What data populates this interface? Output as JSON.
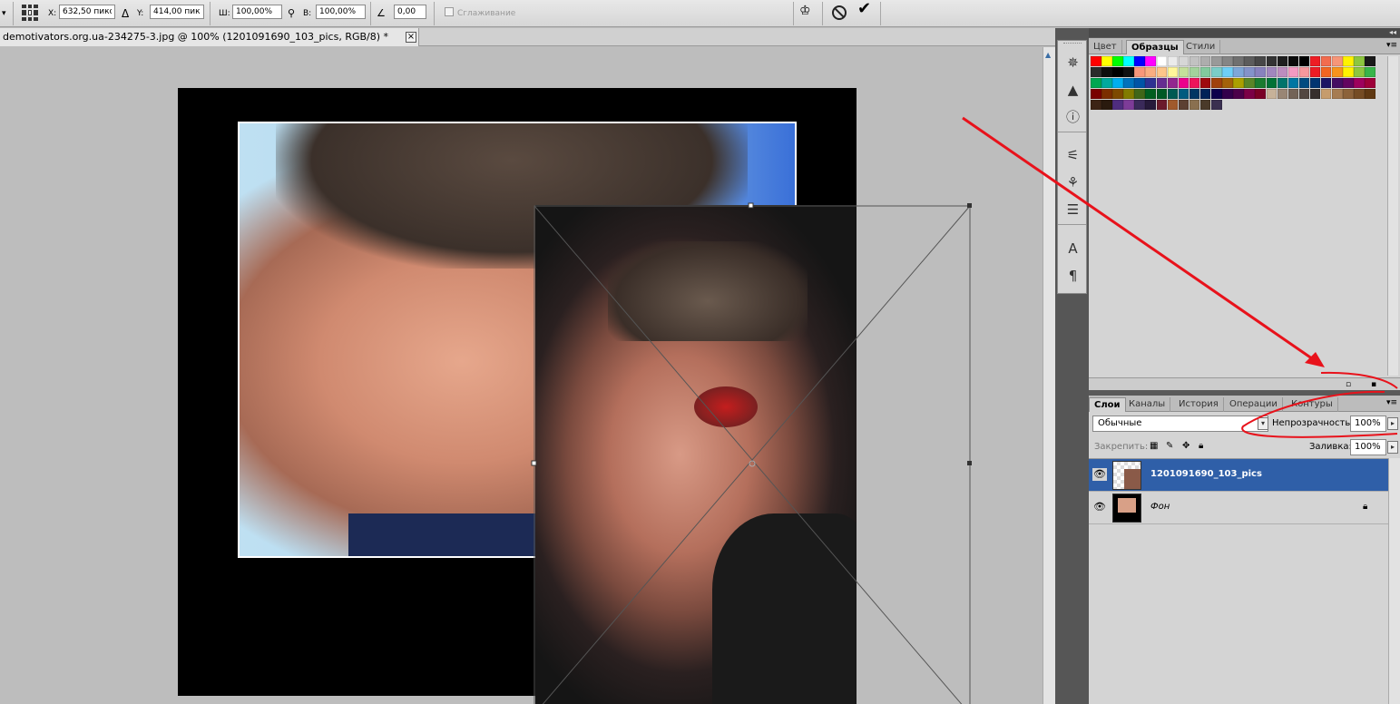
{
  "options_bar": {
    "x_label": "X:",
    "x_value": "632,50 пикс",
    "delta_icon": "Δ",
    "y_label": "Y:",
    "y_value": "414,00 пикс",
    "w_label": "Ш:",
    "w_value": "100,00%",
    "h_label": "В:",
    "h_value": "100,00%",
    "angle_value": "0,00",
    "antialias_label": "Сглаживание",
    "icons": [
      "reference-point-icon",
      "link-icon",
      "angle-icon",
      "warp-icon",
      "cancel-icon",
      "commit-icon"
    ]
  },
  "document": {
    "tab_title": "demotivators.org.ua-234275-3.jpg @ 100% (1201091690_103_pics, RGB/8) *",
    "close_label": "×"
  },
  "swatch_panel": {
    "collapse_label": "◂◂",
    "tabs": [
      "Цвет",
      "Образцы",
      "Стили"
    ],
    "active_tab": "Образцы",
    "swatches": [
      "#ff0000",
      "#ffff00",
      "#00ff00",
      "#00ffff",
      "#0000ff",
      "#ff00ff",
      "#ffffff",
      "#ebebeb",
      "#d6d6d6",
      "#c2c2c2",
      "#adadad",
      "#999999",
      "#858585",
      "#707070",
      "#5c5c5c",
      "#474747",
      "#333333",
      "#1f1f1f",
      "#0a0a0a",
      "#000000",
      "#ee1d24",
      "#f26c4f",
      "#f69679",
      "#fff200",
      "#8dc63f",
      "#1a1a1a",
      "#2b2b2b",
      "#0d0d0d",
      "#000000",
      "#101010",
      "#f7977a",
      "#f9ad81",
      "#fdc68a",
      "#fff79a",
      "#c4df9b",
      "#a3d39c",
      "#82ca9d",
      "#7bcdc8",
      "#6ecff6",
      "#7ea7d8",
      "#8493ca",
      "#8882be",
      "#a187be",
      "#bc8dbf",
      "#f49ac2",
      "#f6989d",
      "#ed1c24",
      "#f26522",
      "#f7941d",
      "#fff200",
      "#8dc73f",
      "#39b54a",
      "#00a651",
      "#00a99d",
      "#00aeef",
      "#0072bc",
      "#0054a6",
      "#2e3192",
      "#662d91",
      "#92278f",
      "#ec008c",
      "#ed145b",
      "#9e0b0f",
      "#a0410d",
      "#a3620a",
      "#aba000",
      "#598527",
      "#1a7b30",
      "#007236",
      "#00746b",
      "#0076a3",
      "#004b80",
      "#003471",
      "#1b1464",
      "#440e62",
      "#630460",
      "#9e005d",
      "#9e0039",
      "#790000",
      "#7b2e00",
      "#7d4900",
      "#827b00",
      "#406618",
      "#005e20",
      "#005826",
      "#005952",
      "#005b7f",
      "#003663",
      "#002157",
      "#0d004c",
      "#32004b",
      "#4b0049",
      "#7b0046",
      "#7a0026",
      "#c7b299",
      "#998675",
      "#736357",
      "#534741",
      "#362f2d",
      "#c69c6d",
      "#a67c52",
      "#8c6239",
      "#754c24",
      "#603913",
      "#3c2415",
      "#2a1a0e",
      "#4f2d7f",
      "#7d3c98",
      "#3a2a5a",
      "#261a3a",
      "#6a1b2b",
      "#a05a2c",
      "#5c4033",
      "#8a7050",
      "#4a3a2a",
      "#3a3050"
    ]
  },
  "layers_panel": {
    "tabs": [
      "Слои",
      "Каналы",
      "История",
      "Операции",
      "Контуры"
    ],
    "active_tab": "Слои",
    "blend_mode": "Обычные",
    "opacity_label": "Непрозрачность:",
    "opacity_value": "100%",
    "lock_label": "Закрепить:",
    "fill_label": "Заливка:",
    "fill_value": "100%",
    "layers": [
      {
        "name": "1201091690_103_pics",
        "selected": true
      },
      {
        "name": "Фон",
        "selected": false,
        "locked": true
      }
    ]
  },
  "colors": {
    "accent_selected": "#2f5fa8",
    "annotation_red": "#e8121b"
  }
}
